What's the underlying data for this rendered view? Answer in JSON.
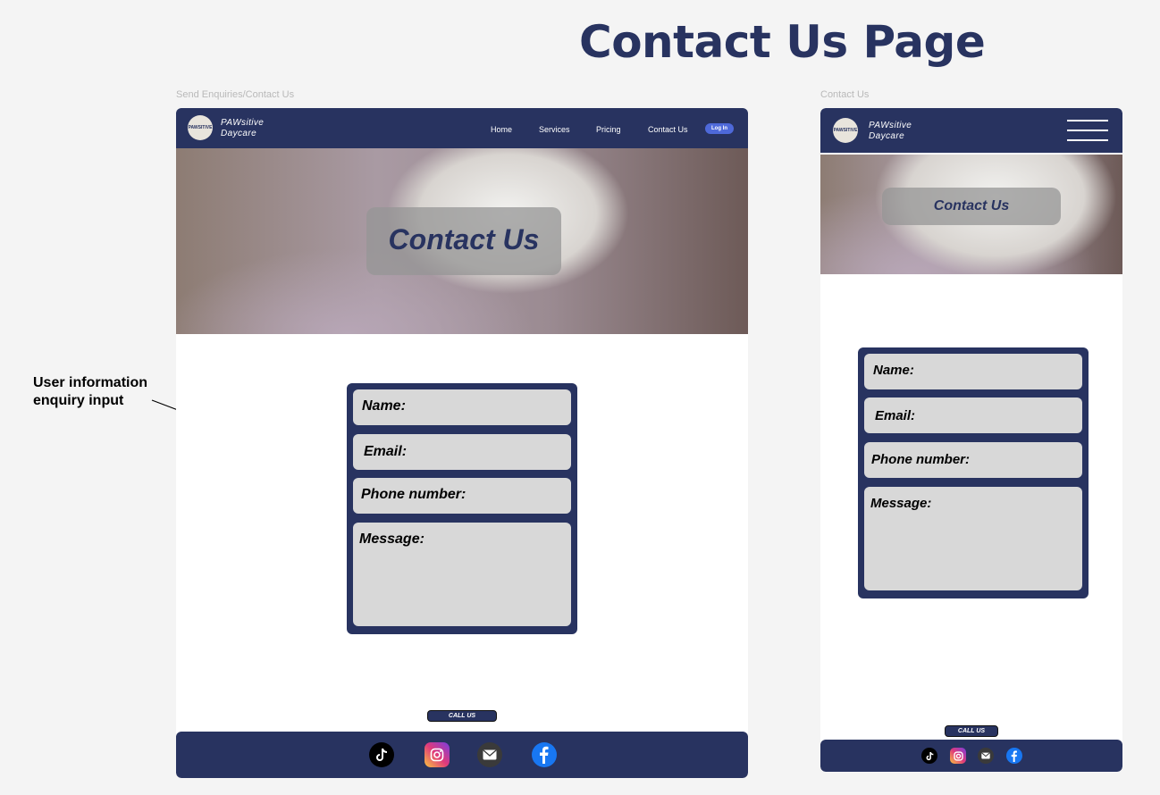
{
  "page_title": "Contact Us Page",
  "desktop": {
    "frame_label": "Send Enquiries/Contact Us",
    "logo_text": "PAWSITIVE",
    "brand_line1": "PAWsitive",
    "brand_line2": "Daycare",
    "nav_items": [
      "Home",
      "Services",
      "Pricing",
      "Contact Us"
    ],
    "login_label": "Log In",
    "hero_title": "Contact Us",
    "fields": [
      "Name:",
      "Email:",
      "Phone number:",
      "Message:"
    ],
    "call_us": "CALL US",
    "socials": [
      "tiktok-icon",
      "instagram-icon",
      "email-icon",
      "facebook-icon"
    ]
  },
  "mobile": {
    "frame_label": "Contact Us",
    "logo_text": "PAWSITIVE",
    "brand_line1": "PAWsitive",
    "brand_line2": "Daycare",
    "hero_title": "Contact Us",
    "fields": [
      "Name:",
      "Email:",
      "Phone number:",
      "Message:"
    ],
    "call_us": "CALL US",
    "socials": [
      "tiktok-icon",
      "instagram-icon",
      "email-icon",
      "facebook-icon"
    ]
  },
  "annotation": {
    "line1": "User information",
    "line2": "enquiry input"
  },
  "colors": {
    "navy": "#283360",
    "login_button": "#4e69d9",
    "field_gray": "#d8d8d8",
    "background": "#f4f4f4"
  }
}
